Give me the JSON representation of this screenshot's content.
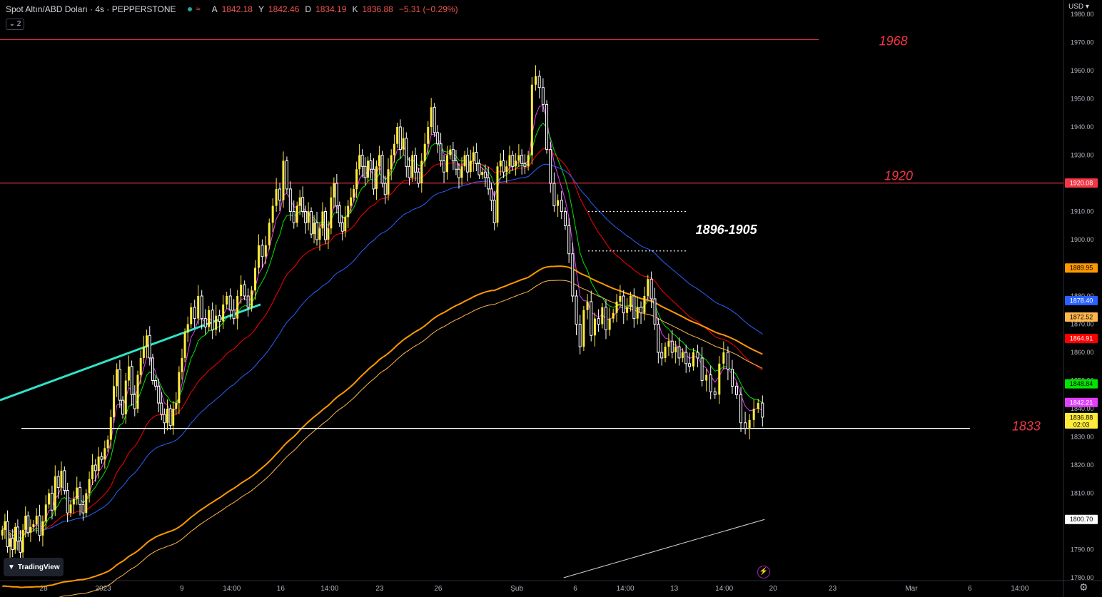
{
  "header": {
    "symbol": "Spot Altın/ABD Doları · 4s · PEPPERSTONE",
    "o_label": "A",
    "o": "1842.18",
    "h_label": "Y",
    "h": "1842.46",
    "l_label": "D",
    "l": "1834.19",
    "c_label": "K",
    "c": "1836.88",
    "change": "−5.31 (−0.29%)",
    "collapse": "2"
  },
  "currency": "USD",
  "logo": "TradingView",
  "colors": {
    "up": "#ffeb3b",
    "down": "#ffffff",
    "resistance": "#f23645",
    "support": "#ffffff",
    "trend": "#30e3c8"
  },
  "chart_data": {
    "type": "candlestick",
    "ylim": [
      1780,
      1982
    ],
    "y_ticks": [
      1780,
      1790,
      1800,
      1810,
      1820,
      1830,
      1840,
      1850,
      1860,
      1870,
      1880,
      1890,
      1900,
      1910,
      1920,
      1930,
      1940,
      1950,
      1960,
      1970,
      1980
    ],
    "x_ticks": [
      {
        "label": "28",
        "x": 0.041
      },
      {
        "label": "2023",
        "x": 0.097
      },
      {
        "label": "9",
        "x": 0.171
      },
      {
        "label": "14:00",
        "x": 0.218
      },
      {
        "label": "16",
        "x": 0.264
      },
      {
        "label": "14:00",
        "x": 0.31
      },
      {
        "label": "23",
        "x": 0.357
      },
      {
        "label": "26",
        "x": 0.412
      },
      {
        "label": "Şub",
        "x": 0.486
      },
      {
        "label": "6",
        "x": 0.541
      },
      {
        "label": "14:00",
        "x": 0.588
      },
      {
        "label": "13",
        "x": 0.634
      },
      {
        "label": "14:00",
        "x": 0.681
      },
      {
        "label": "20",
        "x": 0.727
      },
      {
        "label": "23",
        "x": 0.783
      },
      {
        "label": "Mar",
        "x": 0.857
      },
      {
        "label": "6",
        "x": 0.912
      },
      {
        "label": "14:00",
        "x": 0.959
      }
    ],
    "levels": [
      {
        "label": "1968",
        "value": 1971,
        "color": "#f23645",
        "x_end": 0.77
      },
      {
        "label": "1920",
        "value": 1920.08,
        "color": "#f23645",
        "x_end": 1.0
      },
      {
        "label": "1833",
        "value": 1833,
        "color": "#ffffff",
        "x_end": 0.912
      }
    ],
    "zone": {
      "label": "1896-1905",
      "top": 1910,
      "bottom": 1896
    },
    "price_labels": [
      {
        "value": "1920.08",
        "price": 1920.08,
        "bg": "#f23645",
        "fg": "#ffffff"
      },
      {
        "value": "1889.95",
        "price": 1889.95,
        "bg": "#ff9800",
        "fg": "#000000"
      },
      {
        "value": "1878.40",
        "price": 1878.4,
        "bg": "#2962ff",
        "fg": "#ffffff"
      },
      {
        "value": "1872.52",
        "price": 1872.52,
        "bg": "#ffb74d",
        "fg": "#000000"
      },
      {
        "value": "1864.91",
        "price": 1864.91,
        "bg": "#ff0000",
        "fg": "#ffffff"
      },
      {
        "value": "1848.84",
        "price": 1848.84,
        "bg": "#00e600",
        "fg": "#000000"
      },
      {
        "value": "1842.21",
        "price": 1842.21,
        "bg": "#e040fb",
        "fg": "#ffffff"
      },
      {
        "value": "1836.88",
        "price": 1836.88,
        "bg": "#ffeb3b",
        "fg": "#000000",
        "sub": "02:03"
      },
      {
        "value": "1800.70",
        "price": 1800.7,
        "bg": "#ffffff",
        "fg": "#000000"
      }
    ],
    "candles": [
      {
        "t": 0.001,
        "p": [
          1797,
          1800,
          1791,
          1794,
          1790,
          1798,
          1793,
          1789,
          1797,
          1802,
          1796,
          1798
        ]
      },
      {
        "t": 0.03,
        "p": [
          1799,
          1802,
          1795,
          1800,
          1806,
          1810,
          1804,
          1816,
          1812,
          1818,
          1811,
          1803
        ]
      },
      {
        "t": 0.065,
        "p": [
          1806,
          1808,
          1812,
          1806,
          1803,
          1810,
          1815,
          1820,
          1818,
          1823,
          1822,
          1826
        ]
      },
      {
        "t": 0.1,
        "p": [
          1829,
          1837,
          1848,
          1854,
          1843,
          1838,
          1850,
          1855,
          1845,
          1840,
          1852,
          1858,
          1862,
          1866,
          1858,
          1850
        ]
      },
      {
        "t": 0.145,
        "p": [
          1848,
          1842,
          1838,
          1835,
          1840,
          1834,
          1840,
          1842,
          1853,
          1858,
          1867,
          1870
        ]
      },
      {
        "t": 0.178,
        "p": [
          1876,
          1872,
          1880,
          1872,
          1869,
          1875,
          1868,
          1873,
          1871,
          1877,
          1880,
          1875,
          1872,
          1880,
          1884,
          1880,
          1876
        ]
      },
      {
        "t": 0.235,
        "p": [
          1882,
          1890,
          1898,
          1894,
          1898,
          1906,
          1912,
          1918,
          1914,
          1928,
          1918,
          1910,
          1906
        ]
      },
      {
        "t": 0.278,
        "p": [
          1912,
          1915,
          1910,
          1906,
          1910,
          1902,
          1906,
          1900,
          1904,
          1910,
          1900,
          1904,
          1915,
          1920,
          1912
        ]
      },
      {
        "t": 0.318,
        "p": [
          1906,
          1903,
          1908,
          1912,
          1915,
          1918,
          1925,
          1930,
          1926,
          1922,
          1928,
          1925,
          1918,
          1926,
          1930
        ]
      },
      {
        "t": 0.358,
        "p": [
          1920,
          1916,
          1925,
          1930,
          1934,
          1940,
          1932,
          1936,
          1926,
          1922,
          1930,
          1924
        ]
      },
      {
        "t": 0.392,
        "p": [
          1920,
          1928,
          1934,
          1940,
          1947,
          1938,
          1934,
          1928,
          1924,
          1930
        ]
      },
      {
        "t": 0.422,
        "p": [
          1932,
          1928,
          1925,
          1922,
          1926,
          1930,
          1924,
          1928,
          1931,
          1927,
          1923
        ]
      },
      {
        "t": 0.452,
        "p": [
          1924,
          1922,
          1918,
          1914,
          1906,
          1926,
          1928,
          1924,
          1926,
          1930,
          1926,
          1928,
          1930,
          1927,
          1926
        ]
      },
      {
        "t": 0.495,
        "p": [
          1930,
          1955,
          1958,
          1954,
          1948,
          1932,
          1920,
          1912,
          1914,
          1910,
          1905,
          1895,
          1880,
          1870,
          1862,
          1875,
          1878,
          1866,
          1872,
          1870,
          1876,
          1868,
          1872
        ]
      },
      {
        "t": 0.575,
        "p": [
          1874,
          1878,
          1880,
          1874,
          1876,
          1880,
          1872,
          1876,
          1874,
          1880,
          1886,
          1879,
          1870,
          1860,
          1858,
          1862,
          1864,
          1860,
          1862,
          1858,
          1860,
          1856,
          1855
        ]
      },
      {
        "t": 0.65,
        "p": [
          1860,
          1858,
          1850,
          1852,
          1846,
          1845,
          1856,
          1860,
          1854,
          1848,
          1845,
          1835,
          1833,
          1836,
          1840,
          1842,
          1837
        ]
      }
    ]
  }
}
